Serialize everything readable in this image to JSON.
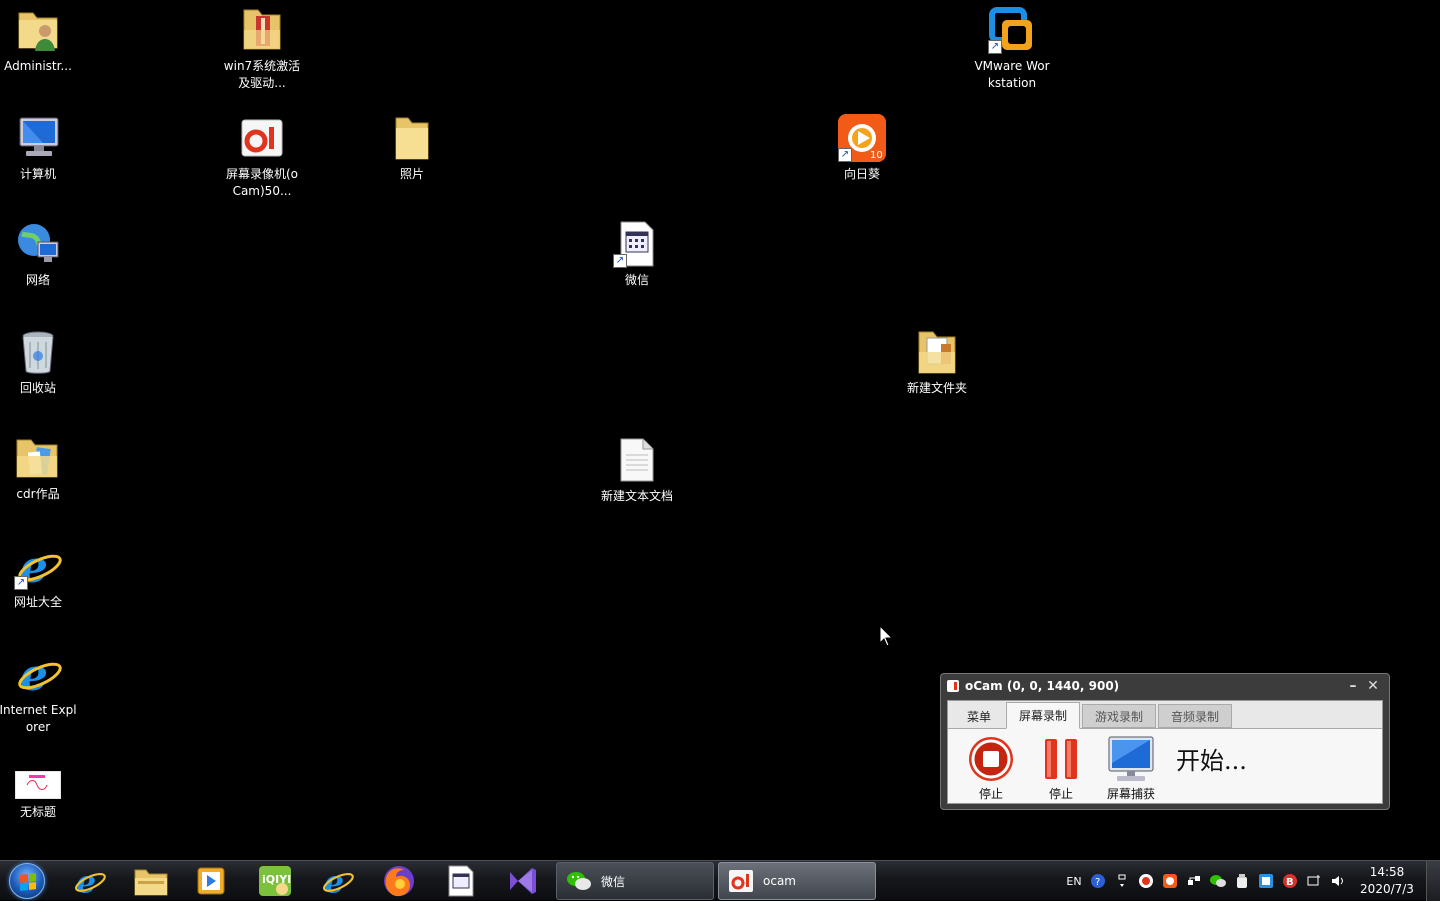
{
  "desktop": {
    "icons": [
      {
        "label": "Administr...",
        "icon": "user-folder-icon"
      },
      {
        "label": "计算机",
        "icon": "computer-icon"
      },
      {
        "label": "网络",
        "icon": "network-icon"
      },
      {
        "label": "回收站",
        "icon": "recycle-bin-icon"
      },
      {
        "label": "cdr作品",
        "icon": "folder-icon"
      },
      {
        "label": "网址大全",
        "icon": "ie-icon"
      },
      {
        "label": "Internet Explorer",
        "icon": "ie-icon"
      },
      {
        "label": "无标题",
        "icon": "image-file-icon"
      },
      {
        "label": "win7系统激活及驱动...",
        "icon": "zip-folder-icon"
      },
      {
        "label": "屏幕录像机(oCam)50...",
        "icon": "ocam-icon"
      },
      {
        "label": "照片",
        "icon": "folder-icon"
      },
      {
        "label": "微信",
        "icon": "shortcut-file-icon"
      },
      {
        "label": "新建文本文档",
        "icon": "text-file-icon"
      },
      {
        "label": "向日葵",
        "icon": "sunflower-icon"
      },
      {
        "label": "VMware Workstation",
        "icon": "vmware-icon"
      },
      {
        "label": "新建文件夹",
        "icon": "folder-icon"
      }
    ]
  },
  "ocam": {
    "title": "oCam (0, 0, 1440, 900)",
    "minimize": "–",
    "close": "✕",
    "tabs": [
      {
        "label": "菜单",
        "state": "normal"
      },
      {
        "label": "屏幕录制",
        "state": "active"
      },
      {
        "label": "游戏录制",
        "state": "inactive"
      },
      {
        "label": "音频录制",
        "state": "inactive"
      }
    ],
    "tools": [
      {
        "label": "停止",
        "icon": "stop-icon"
      },
      {
        "label": "停止",
        "icon": "pause-icon"
      },
      {
        "label": "屏幕捕获",
        "icon": "screen-capture-icon"
      }
    ],
    "status": "开始..."
  },
  "taskbar": {
    "tasks": [
      {
        "label": "微信",
        "icon": "wechat-icon"
      },
      {
        "label": "ocam",
        "icon": "ocam-icon"
      }
    ],
    "tray": {
      "lang": "EN"
    },
    "clock": {
      "time": "14:58",
      "date": "2020/7/3"
    }
  },
  "colors": {
    "desktop_bg": "#000000",
    "ocam_record": "#e0341c"
  }
}
